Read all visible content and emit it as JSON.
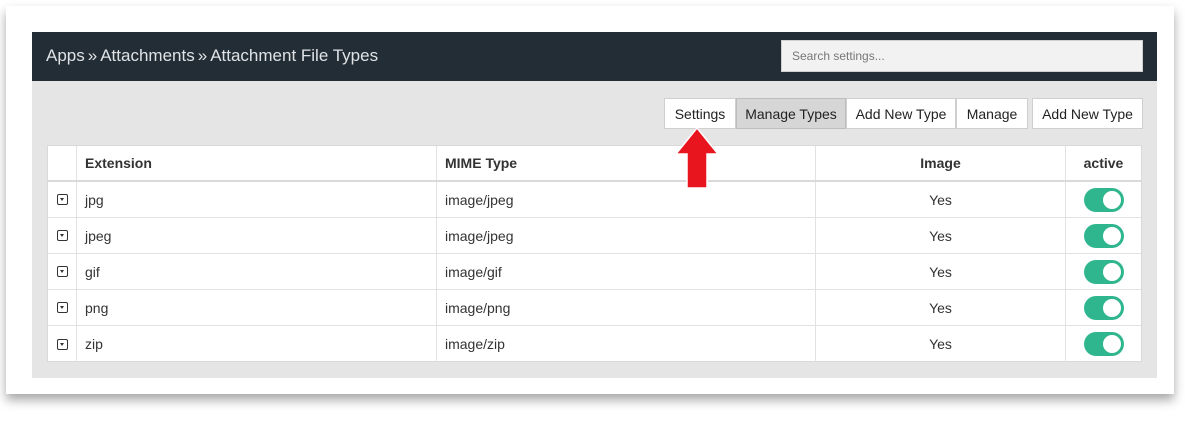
{
  "breadcrumb": {
    "items": [
      "Apps",
      "Attachments",
      "Attachment File Types"
    ],
    "separator": "»"
  },
  "search": {
    "placeholder": "Search settings..."
  },
  "toolbar": {
    "buttons": [
      {
        "label": "Settings"
      },
      {
        "label": "Manage Types",
        "active": true
      },
      {
        "label": "Add New Type"
      },
      {
        "label": "Manage"
      },
      {
        "label": "Add New Type"
      }
    ]
  },
  "table": {
    "headers": [
      "Extension",
      "MIME Type",
      "Image",
      "active"
    ],
    "rows": [
      {
        "extension": "jpg",
        "mime": "image/jpeg",
        "image": "Yes",
        "active": true
      },
      {
        "extension": "jpeg",
        "mime": "image/jpeg",
        "image": "Yes",
        "active": true
      },
      {
        "extension": "gif",
        "mime": "image/gif",
        "image": "Yes",
        "active": true
      },
      {
        "extension": "png",
        "mime": "image/png",
        "image": "Yes",
        "active": true
      },
      {
        "extension": "zip",
        "mime": "image/zip",
        "image": "Yes",
        "active": true
      }
    ]
  },
  "annotation": {
    "icon": "up-arrow-icon",
    "color": "#e8141e"
  },
  "colors": {
    "topbar": "#232d35",
    "toggle_on": "#2fb68e"
  }
}
